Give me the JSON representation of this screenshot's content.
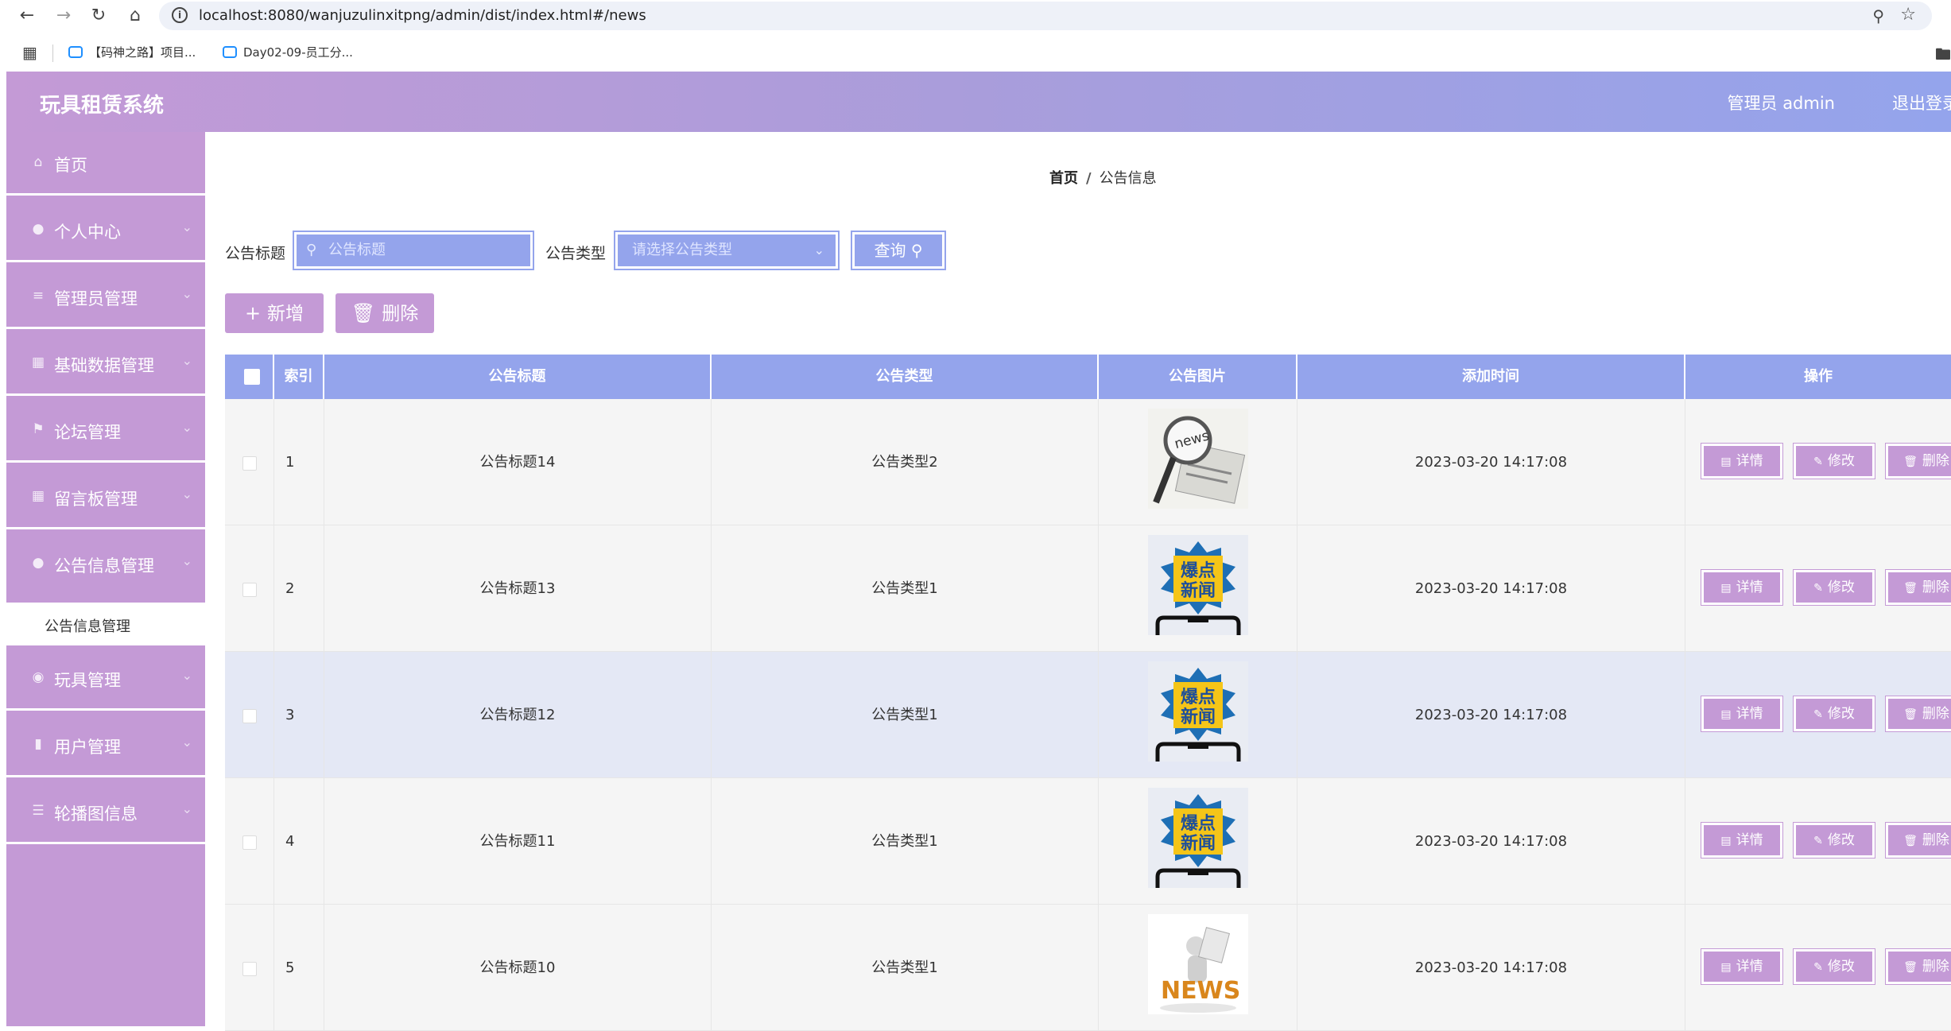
{
  "browser": {
    "url": "localhost:8080/wanjuzulinxitpng/admin/dist/index.html#/news",
    "bookmarks": [
      "【码神之路】项目...",
      "Day02-09-员工分..."
    ]
  },
  "header": {
    "app_title": "玩具租赁系统",
    "admin_label": "管理员 admin",
    "logout_label": "退出登录"
  },
  "sidebar": {
    "items": [
      {
        "label": "首页",
        "icon": "home-icon"
      },
      {
        "label": "个人中心",
        "icon": "user-icon"
      },
      {
        "label": "管理员管理",
        "icon": "sliders-icon"
      },
      {
        "label": "基础数据管理",
        "icon": "grid-icon"
      },
      {
        "label": "论坛管理",
        "icon": "flag-icon"
      },
      {
        "label": "留言板管理",
        "icon": "grid-icon"
      },
      {
        "label": "公告信息管理",
        "icon": "user-icon"
      },
      {
        "label": "玩具管理",
        "icon": "location-icon"
      },
      {
        "label": "用户管理",
        "icon": "bar-chart-icon"
      },
      {
        "label": "轮播图信息",
        "icon": "list-icon"
      }
    ],
    "submenu_label": "公告信息管理"
  },
  "breadcrumb": {
    "home": "首页",
    "separator": "/",
    "current": "公告信息"
  },
  "search": {
    "title_label": "公告标题",
    "title_placeholder": "公告标题",
    "type_label": "公告类型",
    "type_placeholder": "请选择公告类型",
    "query_label": "查询"
  },
  "actions": {
    "add_label": "新增",
    "delete_label": "删除"
  },
  "table": {
    "columns": [
      "索引",
      "公告标题",
      "公告类型",
      "公告图片",
      "添加时间",
      "操作"
    ],
    "rows": [
      {
        "index": "1",
        "title": "公告标题14",
        "type": "公告类型2",
        "image": "news-magnifier",
        "time": "2023-03-20 14:17:08"
      },
      {
        "index": "2",
        "title": "公告标题13",
        "type": "公告类型1",
        "image": "breaking-news",
        "time": "2023-03-20 14:17:08"
      },
      {
        "index": "3",
        "title": "公告标题12",
        "type": "公告类型1",
        "image": "breaking-news",
        "time": "2023-03-20 14:17:08"
      },
      {
        "index": "4",
        "title": "公告标题11",
        "type": "公告类型1",
        "image": "breaking-news",
        "time": "2023-03-20 14:17:08"
      },
      {
        "index": "5",
        "title": "公告标题10",
        "type": "公告类型1",
        "image": "news-figure",
        "time": "2023-03-20 14:17:08"
      }
    ],
    "ops": {
      "detail": "详情",
      "edit": "修改",
      "delete": "删除"
    },
    "thumb_text": {
      "news": "news",
      "breaking_line1": "爆点",
      "breaking_line2": "新闻",
      "news_caps": "NEWS"
    }
  },
  "colors": {
    "purple": "#c49ad6",
    "blue": "#94a4ec"
  }
}
